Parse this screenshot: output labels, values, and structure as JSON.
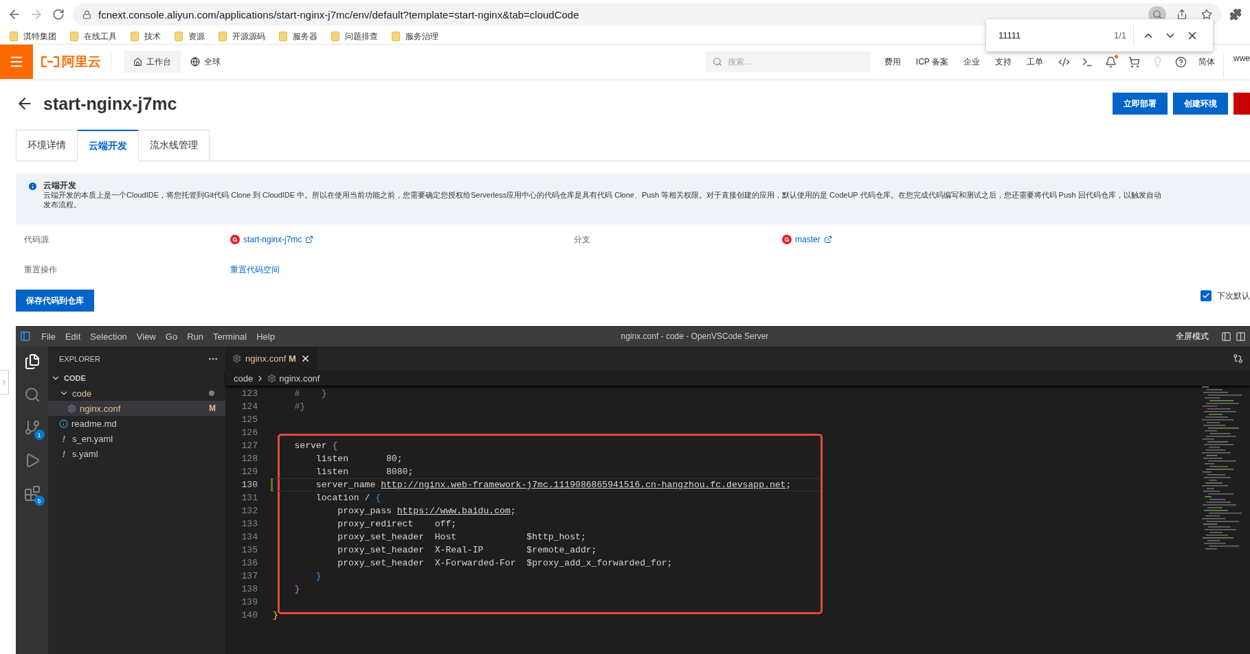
{
  "browser": {
    "url": "fcnext.console.aliyun.com/applications/start-nginx-j7mc/env/default?template=start-nginx&tab=cloudCode",
    "bookmarks": [
      "淇特集团",
      "在线工具",
      "技术",
      "资源",
      "开源源码",
      "服务器",
      "问题排查",
      "服务治理"
    ]
  },
  "find_bar": {
    "query": "11111",
    "count": "1/1"
  },
  "header": {
    "logo": "阿里云",
    "workbench": "工作台",
    "region": "全球",
    "search_placeholder": "搜索...",
    "nav": [
      "费用",
      "ICP 备案",
      "企业",
      "支持",
      "工单"
    ],
    "language": "简体",
    "user": "wwe"
  },
  "page": {
    "title": "start-nginx-j7mc",
    "actions": [
      {
        "label": "立即部署",
        "kind": "primary"
      },
      {
        "label": "创建环境",
        "kind": "primary"
      },
      {
        "kind": "danger"
      }
    ],
    "tabs": [
      {
        "label": "环境详情",
        "selected": false
      },
      {
        "label": "云端开发",
        "selected": true
      },
      {
        "label": "流水线管理",
        "selected": false
      }
    ],
    "notice": {
      "title": "云端开发",
      "lines": [
        "云端开发的本质上是一个CloudIDE，将您托管到Git代码 Clone 到 CloudIDE 中。所以在使用当前功能之前，您需要确定您授权给Serverless应用中心的代码仓库是具有代码 Clone、Push 等相关权限。对于直接创建的应用，默认使用的是 CodeUP 代码仓库。在您完成代码编写和测试之后，您还需要将代码 Push 回代码仓库，以触发自动",
        "发布流程。"
      ]
    },
    "fields": [
      [
        {
          "label": "代码源",
          "value": "start-nginx-j7mc",
          "kind": "repo",
          "icon": "G"
        },
        {
          "label": "分支",
          "value": "master",
          "kind": "repo",
          "icon": "G"
        }
      ],
      [
        {
          "label": "重置操作",
          "value": "重置代码空间",
          "kind": "link"
        }
      ]
    ],
    "save_button": "保存代码到仓库",
    "default_checkbox": {
      "label": "下次默认",
      "checked": true
    }
  },
  "ide": {
    "menu": [
      "File",
      "Edit",
      "Selection",
      "View",
      "Go",
      "Run",
      "Terminal",
      "Help"
    ],
    "title": "nginx.conf - code - OpenVSCode Server",
    "fullscreen": "全屏模式",
    "activity": [
      {
        "kind": "files",
        "selected": true
      },
      {
        "kind": "search",
        "selected": false
      },
      {
        "kind": "scm",
        "selected": false,
        "badge": "1"
      },
      {
        "kind": "run",
        "selected": false
      },
      {
        "kind": "extensions",
        "selected": false,
        "badge": "5"
      }
    ],
    "explorer": {
      "title": "EXPLORER",
      "root": "CODE",
      "tree": [
        {
          "name": "code",
          "kind": "folder",
          "expanded": true,
          "modified": true,
          "selected": false,
          "children": [
            {
              "name": "nginx.conf",
              "kind": "gear",
              "modified": true,
              "badge": "M",
              "selected": true
            }
          ]
        },
        {
          "name": "readme.md",
          "kind": "info",
          "modified": false,
          "selected": false
        },
        {
          "name": "s_en.yaml",
          "kind": "yaml",
          "icon": "!",
          "modified": false,
          "selected": false
        },
        {
          "name": "s.yaml",
          "kind": "yaml",
          "icon": "!",
          "modified": false,
          "selected": false
        }
      ]
    },
    "tab": {
      "label": "nginx.conf",
      "badge": "M"
    },
    "breadcrumb": [
      "code",
      "nginx.conf"
    ],
    "code_blocks": [
      {
        "framed": false,
        "lines": [
          {
            "num": "123",
            "current": false,
            "changed": false,
            "segments": [
              {
                "text": "    #    }",
                "kind": "comment"
              }
            ]
          },
          {
            "num": "124",
            "current": false,
            "changed": false,
            "segments": [
              {
                "text": "    #}",
                "kind": "comment"
              }
            ]
          },
          {
            "num": "125",
            "current": false,
            "changed": false
          },
          {
            "num": "126",
            "current": false,
            "changed": false
          }
        ]
      },
      {
        "framed": true,
        "lines": [
          {
            "num": "127",
            "current": false,
            "changed": false,
            "segments": [
              {
                "text": "    server ",
                "kind": "plain"
              },
              {
                "text": "{",
                "kind": "brace1"
              }
            ]
          },
          {
            "num": "128",
            "current": false,
            "changed": false,
            "segments": [
              {
                "text": "        listen       80;",
                "kind": "plain"
              }
            ]
          },
          {
            "num": "129",
            "current": false,
            "changed": false,
            "segments": [
              {
                "text": "        listen       8080;",
                "kind": "plain"
              }
            ]
          },
          {
            "num": "130",
            "current": true,
            "changed": true,
            "segments": [
              {
                "text": "        server_name ",
                "kind": "plain"
              },
              {
                "text": "http://nginx.web-framework-j7mc.1119086865941516.cn-hangzhou.fc.devsapp.net",
                "kind": "link"
              },
              {
                "text": ";",
                "kind": "plain"
              }
            ]
          },
          {
            "num": "131",
            "current": false,
            "changed": false,
            "segments": [
              {
                "text": "        location / ",
                "kind": "plain"
              },
              {
                "text": "{",
                "kind": "brace2"
              }
            ]
          },
          {
            "num": "132",
            "current": false,
            "changed": false,
            "segments": [
              {
                "text": "            proxy_pass ",
                "kind": "plain"
              },
              {
                "text": "https://www.baidu.com",
                "kind": "link"
              },
              {
                "text": ";",
                "kind": "plain"
              }
            ]
          },
          {
            "num": "133",
            "current": false,
            "changed": false,
            "segments": [
              {
                "text": "            proxy_redirect    off;",
                "kind": "plain"
              }
            ]
          },
          {
            "num": "134",
            "current": false,
            "changed": false,
            "segments": [
              {
                "text": "            proxy_set_header  Host             $http_host;",
                "kind": "plain"
              }
            ]
          },
          {
            "num": "135",
            "current": false,
            "changed": false,
            "segments": [
              {
                "text": "            proxy_set_header  X-Real-IP        $remote_addr;",
                "kind": "plain"
              }
            ]
          },
          {
            "num": "136",
            "current": false,
            "changed": false,
            "segments": [
              {
                "text": "            proxy_set_header  X-Forwarded-For  $proxy_add_x_forwarded_for;",
                "kind": "plain"
              }
            ]
          },
          {
            "num": "137",
            "current": false,
            "changed": false,
            "segments": [
              {
                "text": "        }",
                "kind": "brace2"
              }
            ]
          },
          {
            "num": "138",
            "current": false,
            "changed": false,
            "segments": [
              {
                "text": "    }",
                "kind": "brace1"
              }
            ]
          },
          {
            "num": "139",
            "current": false,
            "changed": false
          }
        ]
      },
      {
        "framed": false,
        "lines": [
          {
            "num": "140",
            "current": false,
            "changed": false,
            "segments": [
              {
                "text": "}",
                "kind": "brace3"
              }
            ]
          }
        ]
      }
    ]
  }
}
